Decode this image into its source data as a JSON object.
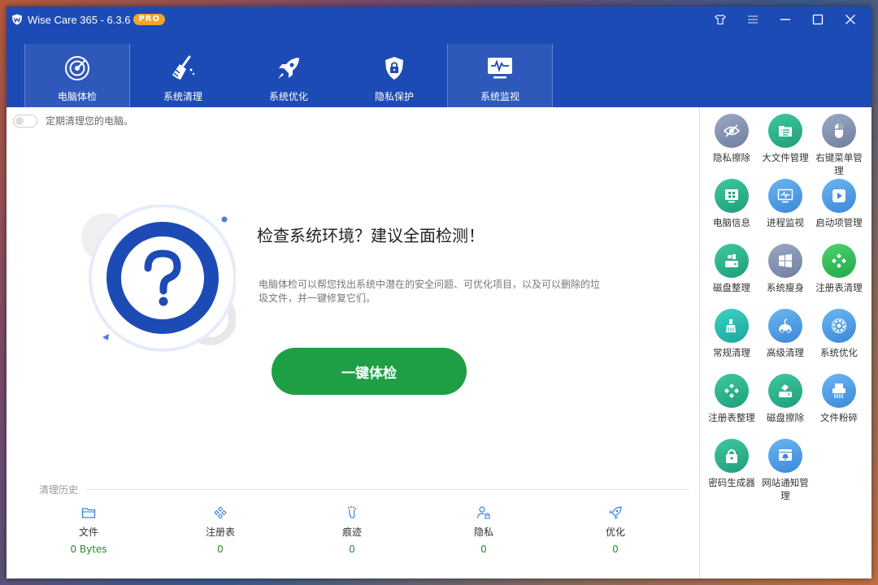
{
  "app": {
    "title": "Wise Care 365 - 6.3.6",
    "badge": "PRO"
  },
  "nav": [
    {
      "label": "电脑体检",
      "icon": "radar-icon"
    },
    {
      "label": "系统清理",
      "icon": "broom-icon"
    },
    {
      "label": "系统优化",
      "icon": "rocket-icon"
    },
    {
      "label": "隐私保护",
      "icon": "lock-shield-icon"
    },
    {
      "label": "系统监视",
      "icon": "monitor-pulse-icon"
    }
  ],
  "toggle": {
    "label": "定期清理您的电脑。"
  },
  "hero": {
    "title": "检查系统环境？建议全面检测！",
    "desc": "电脑体检可以帮您找出系统中潜在的安全问题、可优化项目，以及可以删除的垃圾文件，并一键修复它们。",
    "button": "一键体检"
  },
  "history": {
    "title": "清理历史",
    "items": [
      {
        "label": "文件",
        "value": "0 Bytes",
        "icon": "folder-icon"
      },
      {
        "label": "注册表",
        "value": "0",
        "icon": "registry-icon"
      },
      {
        "label": "痕迹",
        "value": "0",
        "icon": "footprint-icon"
      },
      {
        "label": "隐私",
        "value": "0",
        "icon": "user-lock-icon"
      },
      {
        "label": "优化",
        "value": "0",
        "icon": "rocket-icon"
      }
    ]
  },
  "tools": [
    {
      "label": "隐私擦除",
      "icon": "eye-slash-icon",
      "color": "#7f8fae"
    },
    {
      "label": "大文件管理",
      "icon": "file-list-icon",
      "color": "#2aae86"
    },
    {
      "label": "右键菜单管理",
      "icon": "mouse-icon",
      "color": "#7f8fae"
    },
    {
      "label": "电脑信息",
      "icon": "windows-grid-icon",
      "color": "#2aae86"
    },
    {
      "label": "进程监视",
      "icon": "monitor-icon",
      "color": "#4a9ae2"
    },
    {
      "label": "启动项管理",
      "icon": "play-icon",
      "color": "#4a9ae2"
    },
    {
      "label": "磁盘整理",
      "icon": "disk-icon",
      "color": "#2aae86"
    },
    {
      "label": "系统瘦身",
      "icon": "windows-icon",
      "color": "#7f8fae"
    },
    {
      "label": "注册表清理",
      "icon": "registry-icon",
      "color": "#2fb858"
    },
    {
      "label": "常规清理",
      "icon": "brush-icon",
      "color": "#28b8ae"
    },
    {
      "label": "高级清理",
      "icon": "vacuum-icon",
      "color": "#4a9ae2"
    },
    {
      "label": "系统优化",
      "icon": "gear-icon",
      "color": "#4a9ae2"
    },
    {
      "label": "注册表整理",
      "icon": "registry-icon",
      "color": "#2aae86"
    },
    {
      "label": "磁盘擦除",
      "icon": "disk-erase-icon",
      "color": "#2aae86"
    },
    {
      "label": "文件粉碎",
      "icon": "shredder-icon",
      "color": "#4a9ae2"
    },
    {
      "label": "密码生成器",
      "icon": "padlock-icon",
      "color": "#2aae86"
    },
    {
      "label": "网站通知管理",
      "icon": "browser-bell-icon",
      "color": "#4a9ae2"
    }
  ]
}
